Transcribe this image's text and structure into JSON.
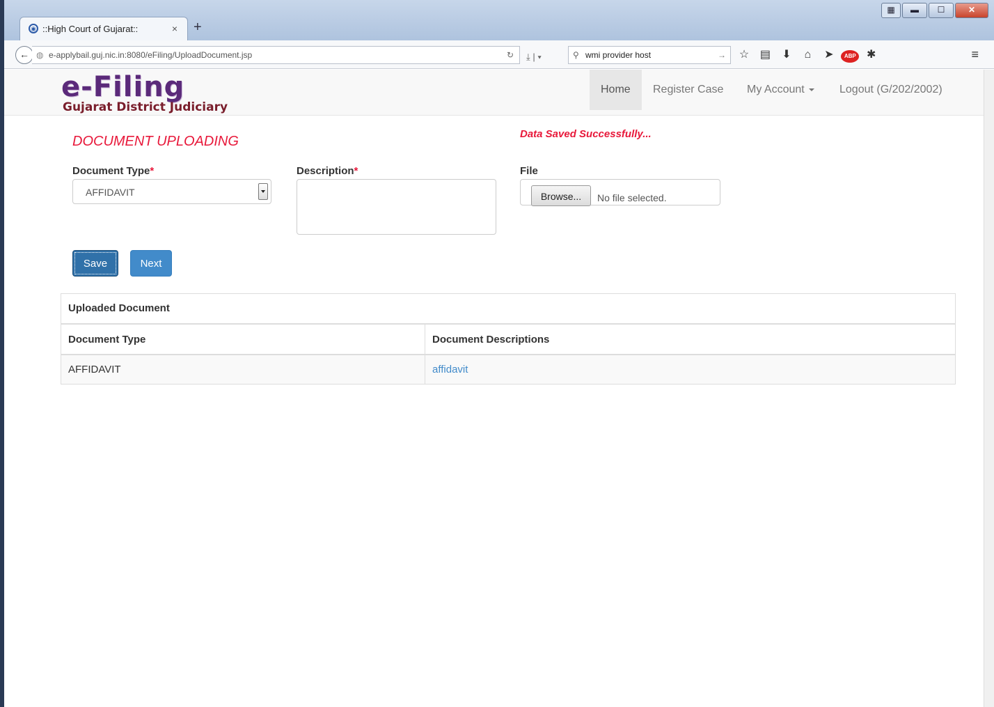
{
  "browser": {
    "tab_title": "::High Court of Gujarat::",
    "tab_close": "×",
    "new_tab": "+",
    "url": "e-applybail.guj.nic.in:8080/eFiling/UploadDocument.jsp",
    "search_text": "wmi provider host",
    "abp_label": "ABP",
    "icons": [
      "back-arrow-icon",
      "globe-icon",
      "reload-icon",
      "download-icon",
      "search-icon",
      "bookmark-star-icon",
      "reading-list-icon",
      "downloads-icon",
      "home-icon",
      "send-icon",
      "adblock-icon",
      "extension-icon",
      "menu-icon"
    ]
  },
  "site": {
    "logo_main": "e-Filing",
    "logo_sub": "Gujarat District Judiciary",
    "nav": {
      "home": "Home",
      "register": "Register Case",
      "account": "My Account",
      "logout": "Logout (G/202/2002)"
    }
  },
  "form": {
    "title": "DOCUMENT UPLOADING",
    "success_message": "Data Saved Successfully...",
    "document_type_label": "Document Type",
    "description_label": "Description",
    "required_mark": "*",
    "file_label": "File",
    "document_type_value": "AFFIDAVIT",
    "description_value": "",
    "browse_label": "Browse...",
    "file_status": "No file selected.",
    "save_label": "Save",
    "next_label": "Next"
  },
  "uploaded": {
    "heading": "Uploaded Document",
    "columns": [
      "Document Type",
      "Document Descriptions"
    ],
    "rows": [
      {
        "type": "AFFIDAVIT",
        "description": "affidavit"
      }
    ]
  },
  "colors": {
    "accent_red": "#e8183a",
    "button_blue": "#428bca",
    "logo_purple": "#5b2a7a"
  }
}
